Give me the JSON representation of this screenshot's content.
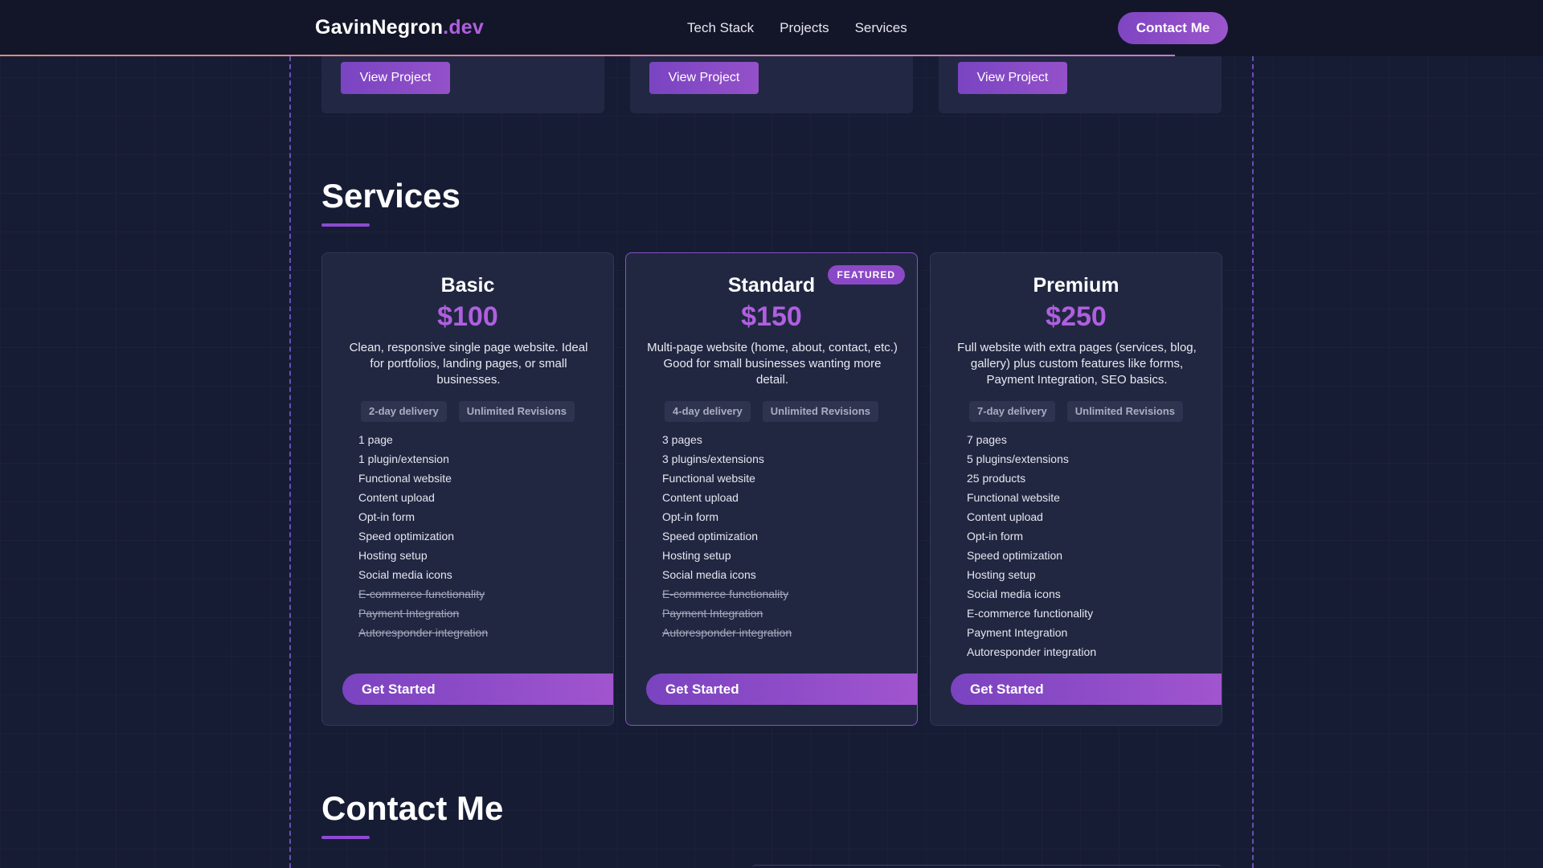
{
  "nav": {
    "logo_main": "GavinNegron",
    "logo_suffix": ".dev",
    "links": [
      "Tech Stack",
      "Projects",
      "Services"
    ],
    "contact_label": "Contact Me"
  },
  "projects": {
    "button_label": "View Project"
  },
  "services": {
    "title": "Services",
    "plans": [
      {
        "name": "Basic",
        "price": "$100",
        "description": "Clean, responsive single page website. Ideal for portfolios, landing pages, or small businesses.",
        "tags": [
          "2-day delivery",
          "Unlimited Revisions"
        ],
        "features": [
          {
            "text": "1 page",
            "included": true
          },
          {
            "text": "1 plugin/extension",
            "included": true
          },
          {
            "text": "Functional website",
            "included": true
          },
          {
            "text": "Content upload",
            "included": true
          },
          {
            "text": "Opt-in form",
            "included": true
          },
          {
            "text": "Speed optimization",
            "included": true
          },
          {
            "text": "Hosting setup",
            "included": true
          },
          {
            "text": "Social media icons",
            "included": true
          },
          {
            "text": "E-commerce functionality",
            "included": false
          },
          {
            "text": "Payment Integration",
            "included": false
          },
          {
            "text": "Autoresponder integration",
            "included": false
          }
        ],
        "cta": "Get Started"
      },
      {
        "name": "Standard",
        "price": "$150",
        "badge": "FEATURED",
        "description": "Multi-page website (home, about, contact, etc.) Good for small businesses wanting more detail.",
        "tags": [
          "4-day delivery",
          "Unlimited Revisions"
        ],
        "features": [
          {
            "text": "3 pages",
            "included": true
          },
          {
            "text": "3 plugins/extensions",
            "included": true
          },
          {
            "text": "Functional website",
            "included": true
          },
          {
            "text": "Content upload",
            "included": true
          },
          {
            "text": "Opt-in form",
            "included": true
          },
          {
            "text": "Speed optimization",
            "included": true
          },
          {
            "text": "Hosting setup",
            "included": true
          },
          {
            "text": "Social media icons",
            "included": true
          },
          {
            "text": "E-commerce functionality",
            "included": false
          },
          {
            "text": "Payment Integration",
            "included": false
          },
          {
            "text": "Autoresponder integration",
            "included": false
          }
        ],
        "cta": "Get Started"
      },
      {
        "name": "Premium",
        "price": "$250",
        "description": "Full website with extra pages (services, blog, gallery) plus custom features like forms, Payment Integration, SEO basics.",
        "tags": [
          "7-day delivery",
          "Unlimited Revisions"
        ],
        "features": [
          {
            "text": "7 pages",
            "included": true
          },
          {
            "text": "5 plugins/extensions",
            "included": true
          },
          {
            "text": "25 products",
            "included": true
          },
          {
            "text": "Functional website",
            "included": true
          },
          {
            "text": "Content upload",
            "included": true
          },
          {
            "text": "Opt-in form",
            "included": true
          },
          {
            "text": "Speed optimization",
            "included": true
          },
          {
            "text": "Hosting setup",
            "included": true
          },
          {
            "text": "Social media icons",
            "included": true
          },
          {
            "text": "E-commerce functionality",
            "included": true
          },
          {
            "text": "Payment Integration",
            "included": true
          },
          {
            "text": "Autoresponder integration",
            "included": true
          }
        ],
        "cta": "Get Started"
      }
    ]
  },
  "contact": {
    "title": "Contact Me"
  },
  "colors": {
    "background": "#171c35",
    "accent": "#b05fe0",
    "button": "#8c49c7"
  }
}
